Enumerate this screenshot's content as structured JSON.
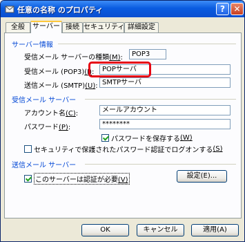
{
  "window": {
    "title": "任意の名称 のプロパティ",
    "help_glyph": "?",
    "close_glyph": "✕"
  },
  "tabs": [
    "全般",
    "サーバー",
    "接続",
    "セキュリティ",
    "詳細設定"
  ],
  "server_info": {
    "group_label": "サーバー情報",
    "incoming_type_label": "受信メール サーバーの種類",
    "incoming_type_key": "(M)",
    "incoming_type_value": "POP3",
    "incoming_label": "受信メール (POP3)",
    "incoming_key": "(I)",
    "incoming_value": "POPサーバ",
    "outgoing_label": "送信メール (SMTP)",
    "outgoing_key": "(U)",
    "outgoing_value": "SMTPサーバ"
  },
  "incoming_server": {
    "group_label": "受信メール サーバー",
    "account_label": "アカウント名",
    "account_key": "(C)",
    "account_value": "メールアカウント",
    "password_label": "パスワード",
    "password_key": "(P)",
    "password_value": "********",
    "remember_label": "パスワードを保存する",
    "remember_key": "(W)",
    "remember_checked": true,
    "spa_label": "セキュリティで保護されたパスワード認証でログオンする",
    "spa_key": "(S)",
    "spa_checked": false
  },
  "outgoing_server": {
    "group_label": "送信メール サーバー",
    "auth_label": "このサーバーは認証が必要",
    "auth_key": "(V)",
    "auth_checked": true,
    "settings_button": "設定(E)..."
  },
  "buttons": {
    "ok": "OK",
    "cancel": "キャンセル",
    "apply": "適用(A)"
  },
  "highlight_color": "#e60012"
}
